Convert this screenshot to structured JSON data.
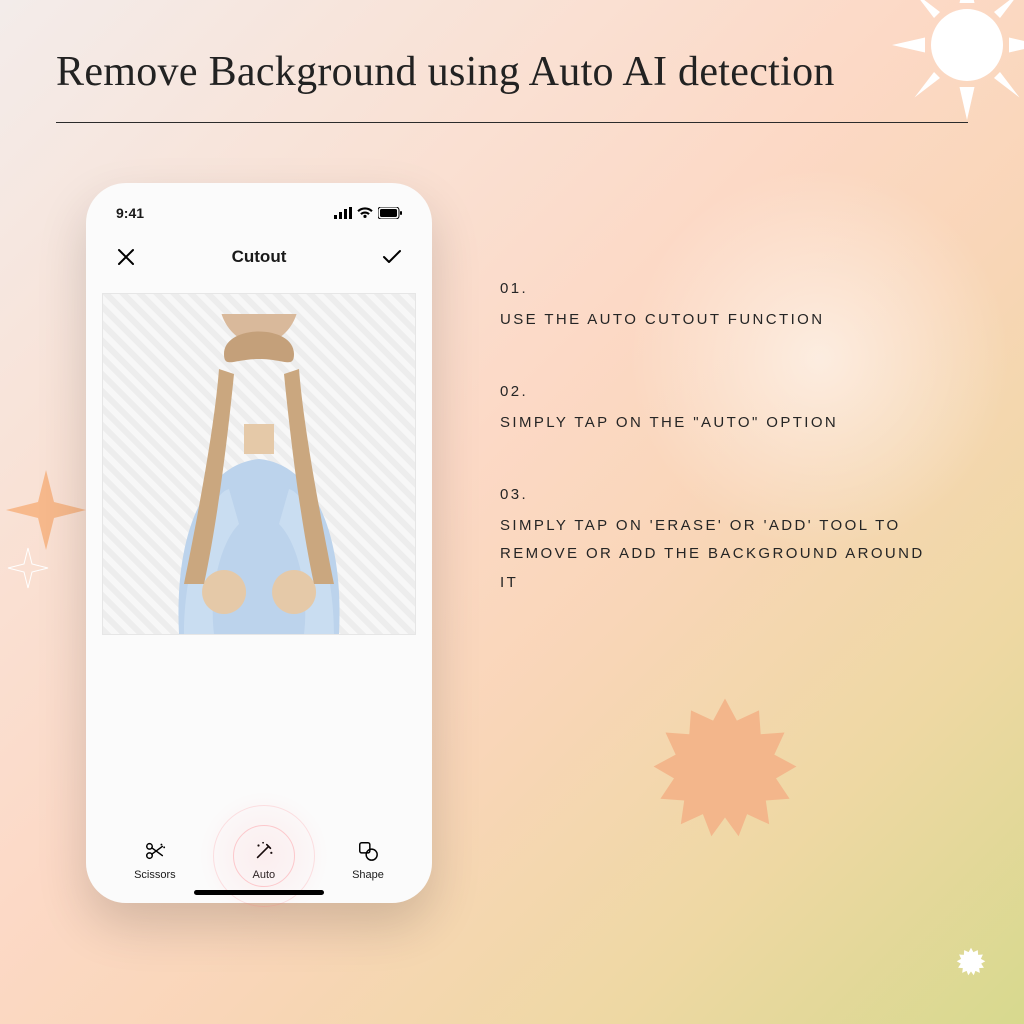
{
  "title": "Remove Background using Auto AI detection",
  "phone": {
    "status_time": "9:41",
    "topbar_title": "Cutout",
    "tools": [
      {
        "label": "Scissors"
      },
      {
        "label": "Auto"
      },
      {
        "label": "Shape"
      }
    ]
  },
  "steps": [
    {
      "num": "01.",
      "text": "USE THE AUTO CUTOUT FUNCTION"
    },
    {
      "num": "02.",
      "text": "SIMPLY TAP ON THE \"AUTO\" OPTION"
    },
    {
      "num": "03.",
      "text": "SIMPLY TAP ON 'ERASE' OR 'ADD' TOOL TO REMOVE OR ADD THE BACKGROUND AROUND IT"
    }
  ]
}
